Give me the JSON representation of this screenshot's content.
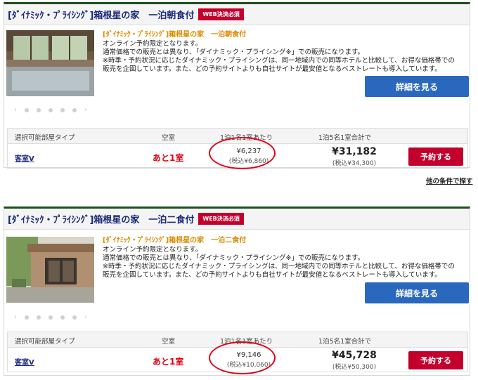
{
  "plans": [
    {
      "title": "[ﾀﾞｲﾅﾐｯｸ・ﾌﾟﾗｲｼﾝｸﾞ]箱根星の家　一泊朝食付",
      "badge": "WEB決済必須",
      "photo": "bath-room-photo",
      "subtitle": "[ﾀﾞｲﾅﾐｯｸ・ﾌﾟﾗｲｼﾝｸﾞ]箱根星の家　一泊朝食付",
      "lines": [
        "オンライン予約限定となります。",
        "通常価格での販売とは異なり、「ダイナミック・プライシング※」での販売になります。",
        "※時季・予約状況に応じたダイナミック・プライシングは、同一地域内での同等ホテルと比較して、お得な価格帯での",
        "販売を企図しています。また、どの予約サイトよりも自社サイトが最安値となるベストレートも導入しています。"
      ],
      "detail_button": "詳細を見る",
      "table": {
        "headers": [
          "選択可能部屋タイプ",
          "空室",
          "1泊1名1室あたり",
          "1泊5名1室合計で"
        ],
        "room": "客室V",
        "vacancy": "あと1室",
        "per_person": "¥6,237",
        "per_person_tax": "(税込¥6,860)",
        "total": "¥31,182",
        "total_tax": "(税込¥34,300)",
        "reserve_button": "予約する"
      }
    },
    {
      "title": "[ﾀﾞｲﾅﾐｯｸ・ﾌﾟﾗｲｼﾝｸﾞ]箱根星の家　一泊二食付",
      "badge": "WEB決済必須",
      "photo": "entrance-photo",
      "subtitle": "[ﾀﾞｲﾅﾐｯｸ・ﾌﾟﾗｲｼﾝｸﾞ]箱根星の家　一泊二食付",
      "lines": [
        "オンライン予約限定となります。",
        "通常価格での販売とは異なり、「ダイナミック・プライシング※」での販売になります。",
        "※時季・予約状況に応じたダイナミック・プライシングは、同一地域内での同等ホテルと比較して、お得な価格帯での",
        "販売を企図しています。また、どの予約サイトよりも自社サイトが最安値となるベストレートも導入しています。"
      ],
      "detail_button": "詳細を見る",
      "table": {
        "headers": [
          "選択可能部屋タイプ",
          "空室",
          "1泊1名1室あたり",
          "1泊5名1室合計で"
        ],
        "room": "客室V",
        "vacancy": "あと1室",
        "per_person": "¥9,146",
        "per_person_tax": "(税込¥10,060)",
        "total": "¥45,728",
        "total_tax": "(税込¥50,300)",
        "reserve_button": "予約する"
      }
    }
  ],
  "other_conditions_link": "他の条件で探す",
  "highlight_color": "#e00018"
}
